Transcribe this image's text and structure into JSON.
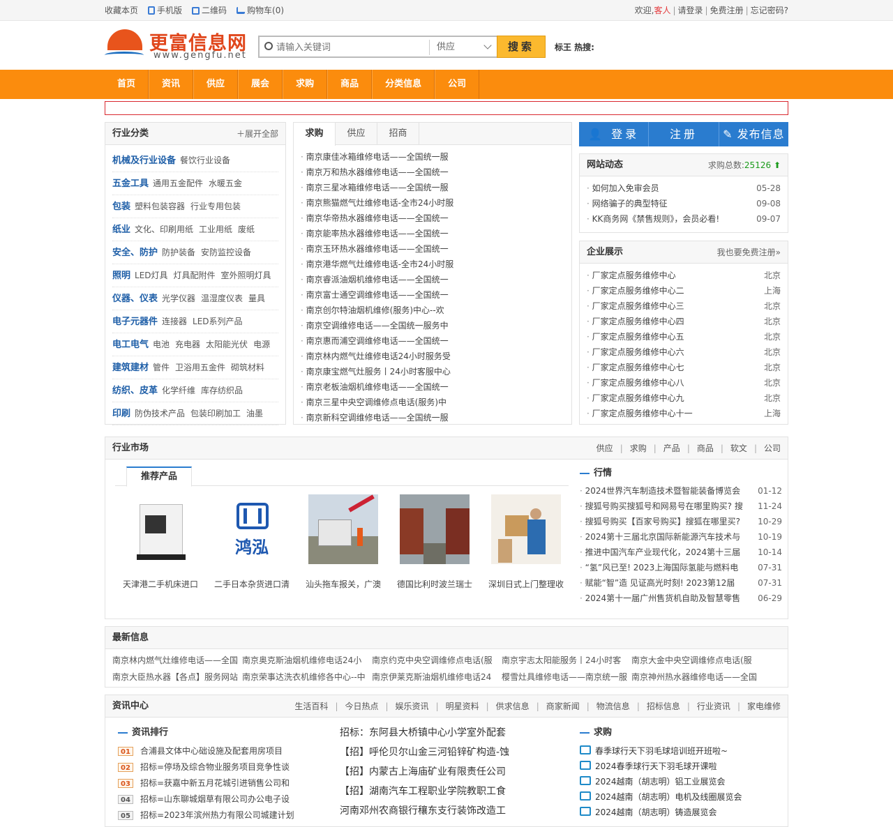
{
  "topbar": {
    "left": [
      "收藏本页",
      "手机版",
      "二维码",
      "购物车(0)"
    ],
    "welcome": "欢迎,",
    "guest": "客人",
    "login": "请登录",
    "register": "免费注册",
    "forgot": "忘记密码?"
  },
  "header": {
    "logo_cn": "更富信息网",
    "logo_en": "www.gengfu.net",
    "search_placeholder": "请输入关键词",
    "search_type": "供应",
    "search_button": "搜索",
    "hot_label": "标王 热搜:"
  },
  "nav": [
    "首页",
    "资讯",
    "供应",
    "展会",
    "求购",
    "商品",
    "分类信息",
    "公司"
  ],
  "industry": {
    "title": "行业分类",
    "expand": "展开全部",
    "rows": [
      {
        "main": "机械及行业设备",
        "subs": [
          "餐饮行业设备"
        ]
      },
      {
        "main": "五金工具",
        "subs": [
          "通用五金配件",
          "水暖五金"
        ]
      },
      {
        "main": "包装",
        "subs": [
          "塑料包装容器",
          "行业专用包装"
        ]
      },
      {
        "main": "纸业",
        "subs": [
          "文化、印刷用纸",
          "工业用纸",
          "废纸"
        ]
      },
      {
        "main": "安全、防护",
        "subs": [
          "防护装备",
          "安防监控设备"
        ]
      },
      {
        "main": "照明",
        "subs": [
          "LED灯具",
          "灯具配附件",
          "室外照明灯具"
        ]
      },
      {
        "main": "仪器、仪表",
        "subs": [
          "光学仪器",
          "温湿度仪表",
          "量具"
        ]
      },
      {
        "main": "电子元器件",
        "subs": [
          "连接器",
          "LED系列产品"
        ]
      },
      {
        "main": "电工电气",
        "subs": [
          "电池",
          "充电器",
          "太阳能光伏",
          "电源"
        ]
      },
      {
        "main": "建筑建材",
        "subs": [
          "管件",
          "卫浴用五金件",
          "砌筑材料"
        ]
      },
      {
        "main": "纺织、皮革",
        "subs": [
          "化学纤维",
          "库存纺织品"
        ]
      },
      {
        "main": "印刷",
        "subs": [
          "防伪技术产品",
          "包装印刷加工",
          "油墨"
        ]
      }
    ]
  },
  "center_tabs": [
    "求购",
    "供应",
    "招商"
  ],
  "center_list": [
    "南京康佳冰箱维修电话——全国统一服",
    "南京万和热水器维修电话——全国统一",
    "南京三星冰箱维修电话——全国统一服",
    "南京熊猫燃气灶维修电话-全市24小时服",
    "南京华帝热水器维修电话——全国统一",
    "南京能率热水器维修电话——全国统一",
    "南京玉环热水器维修电话——全国统一",
    "南京港华燃气灶维修电话-全市24小时服",
    "南京睿派油烟机维修电话——全国统一",
    "南京富士通空调维修电话——全国统一",
    "南京创尔特油烟机维修(服务)中心--欢",
    "南京空调维修电话——全国统一服务中",
    "南京惠而浦空调维修电话——全国统一",
    "南京林内燃气灶维修电话24小时服务受",
    "南京康宝燃气灶服务丨24小时客服中心",
    "南京老板油烟机维修电话——全国统一",
    "南京三星中央空调维修点电话(服务)中",
    "南京新科空调维修电话——全国统一服"
  ],
  "actions": [
    "登录",
    "注册",
    "发布信息"
  ],
  "site_news": {
    "title": "网站动态",
    "count_label": "求购总数:",
    "count": "25126",
    "items": [
      {
        "t": "如何加入免审会员",
        "d": "05-28"
      },
      {
        "t": "网络骗子的典型特征",
        "d": "09-08"
      },
      {
        "t": "KK商务网《禁售规则》，会员必看!",
        "d": "09-07"
      }
    ]
  },
  "companies": {
    "title": "企业展示",
    "more": "我也要免费注册»",
    "items": [
      {
        "t": "厂家定点服务维修中心",
        "c": "北京"
      },
      {
        "t": "厂家定点服务维修中心二",
        "c": "上海"
      },
      {
        "t": "厂家定点服务维修中心三",
        "c": "北京"
      },
      {
        "t": "厂家定点服务维修中心四",
        "c": "北京"
      },
      {
        "t": "厂家定点服务维修中心五",
        "c": "北京"
      },
      {
        "t": "厂家定点服务维修中心六",
        "c": "北京"
      },
      {
        "t": "厂家定点服务维修中心七",
        "c": "北京"
      },
      {
        "t": "厂家定点服务维修中心八",
        "c": "北京"
      },
      {
        "t": "厂家定点服务维修中心九",
        "c": "北京"
      },
      {
        "t": "厂家定点服务维修中心十一",
        "c": "上海"
      }
    ]
  },
  "market": {
    "title": "行业市场",
    "links": [
      "供应",
      "求购",
      "产品",
      "商品",
      "软文",
      "公司"
    ],
    "subtab": "推荐产品",
    "products": [
      "天津港二手机床进口",
      "二手日本杂货进口清",
      "汕头拖车报关，广澳",
      "德国比利时波兰瑞士",
      "深圳日式上门整理收"
    ],
    "hq_title": "行情",
    "hq": [
      {
        "t": "2024世界汽车制造技术暨智能装备博览会",
        "d": "01-12"
      },
      {
        "t": "搜狐号购买搜狐号和网易号在哪里购买? 搜",
        "d": "11-24"
      },
      {
        "t": "搜狐号购买【百家号购买】搜狐在哪里买?",
        "d": "10-29"
      },
      {
        "t": "2024第十三届北京国际新能源汽车技术与",
        "d": "10-19"
      },
      {
        "t": "推进中国汽车产业现代化，2024第十三届",
        "d": "10-14"
      },
      {
        "t": "“氢”风已至! 2023上海国际氢能与燃料电",
        "d": "07-31"
      },
      {
        "t": "赋能“智”造 见证高光时刻! 2023第12届",
        "d": "07-31"
      },
      {
        "t": "2024第十一届广州售货机自助及智慧零售",
        "d": "06-29"
      }
    ]
  },
  "latest": {
    "title": "最新信息",
    "items": [
      "南京林内燃气灶维修电话——全国",
      "南京奥克斯油烟机维修电话24小",
      "南京约克中央空调维修点电话(服",
      "南京宇志太阳能服务丨24小时客",
      "南京大金中央空调维修点电话(服",
      "南京大臣热水器【各点】服务网站",
      "南京荣事达洗衣机维修各中心--中",
      "南京伊莱克斯油烟机维修电话24",
      "樱雪灶具维修电话——南京统一服",
      "南京神州热水器维修电话——全国"
    ]
  },
  "news_center": {
    "title": "资讯中心",
    "links": [
      "生活百科",
      "今日热点",
      "娱乐资讯",
      "明星资料",
      "供求信息",
      "商家新闻",
      "物流信息",
      "招标信息",
      "行业资讯",
      "家电维修"
    ],
    "rank_title": "资讯排行",
    "rank": [
      {
        "n": "01",
        "t": "合浦县文体中心础设施及配套用房项目"
      },
      {
        "n": "02",
        "t": "招标=停场及综合物业服务项目竞争性谈"
      },
      {
        "n": "03",
        "t": "招标=获嘉中新五月花城引进销售公司和"
      },
      {
        "n": "04",
        "t": "招标=山东聊城烟草有限公司办公电子设"
      },
      {
        "n": "05",
        "t": "招标=2023年滨州热力有限公司城建计划"
      }
    ],
    "mid": [
      "招标：东阿县大桥镇中心小学室外配套",
      "【招】呼伦贝尔山金三河铅锌矿构造-蚀",
      "【招】内蒙古上海庙矿业有限责任公司",
      "【招】湖南汽车工程职业学院教职工食",
      "河南邓州农商银行穰东支行装饰改造工"
    ],
    "buy_title": "求购",
    "buy": [
      "春季球行天下羽毛球培训班开班啦~",
      "2024春季球行天下羽毛球开课啦",
      "2024越南（胡志明）铝工业展览会",
      "2024越南（胡志明）电机及线圈展览会",
      "2024越南（胡志明）铸造展览会"
    ]
  },
  "colors": {
    "accent": "#fb8c0d",
    "link_blue": "#1f5fa8",
    "button_blue": "#2a7ccf",
    "search_button": "#fbb92e"
  }
}
